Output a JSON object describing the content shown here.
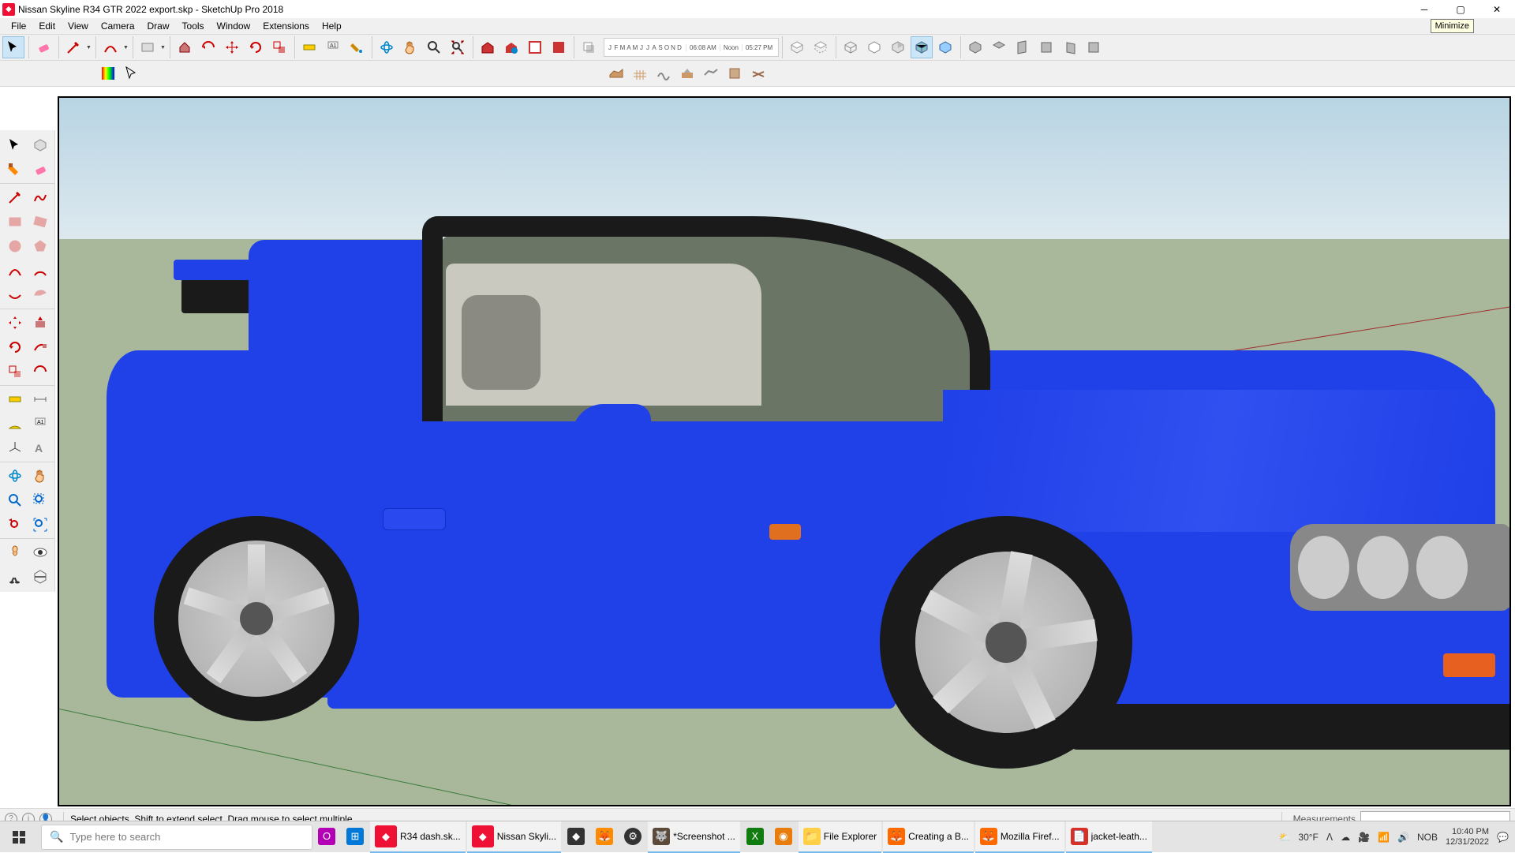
{
  "titlebar": {
    "filename": "Nissan Skyline R34 GTR 2022 export.skp",
    "appname": "SketchUp Pro 2018",
    "tooltip": "Minimize"
  },
  "menu": [
    "File",
    "Edit",
    "View",
    "Camera",
    "Draw",
    "Tools",
    "Window",
    "Extensions",
    "Help"
  ],
  "shadows": {
    "months": [
      "J",
      "F",
      "M",
      "A",
      "M",
      "J",
      "J",
      "A",
      "S",
      "O",
      "N",
      "D"
    ],
    "t1": "06:08 AM",
    "t2": "Noon",
    "t3": "05:27 PM"
  },
  "status": {
    "hint": "Select objects. Shift to extend select. Drag mouse to select multiple.",
    "measure_label": "Measurements"
  },
  "taskbar": {
    "search_placeholder": "Type here to search",
    "items": [
      {
        "label": "",
        "color": "#b400b4"
      },
      {
        "label": "",
        "color": "#0078d7"
      },
      {
        "label": "R34 dash.sk...",
        "color": "#e13"
      },
      {
        "label": "Nissan Skyli...",
        "color": "#e13"
      },
      {
        "label": "",
        "color": "#333"
      },
      {
        "label": "",
        "color": "#ff8c00"
      },
      {
        "label": "",
        "color": "#333"
      },
      {
        "label": "*Screenshot ...",
        "color": "#5c4b3b"
      },
      {
        "label": "",
        "color": "#107c10"
      },
      {
        "label": "",
        "color": "#e87d0d"
      },
      {
        "label": "File Explorer",
        "color": "#ffcf48"
      },
      {
        "label": "Creating a B...",
        "color": "#ff6a00"
      },
      {
        "label": "Mozilla Firef...",
        "color": "#ff6a00"
      },
      {
        "label": "jacket-leath...",
        "color": "#d93025"
      }
    ],
    "weather_temp": "30°F",
    "ime": "NOB",
    "time": "10:40 PM",
    "date": "12/31/2022"
  }
}
